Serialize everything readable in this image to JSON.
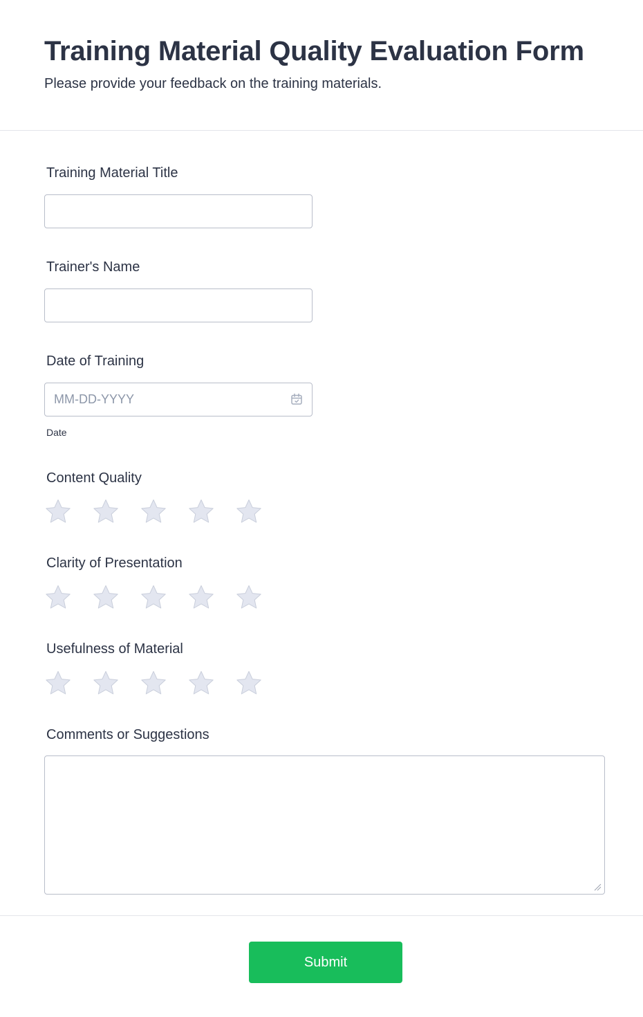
{
  "form": {
    "title": "Training Material Quality Evaluation Form",
    "subtitle": "Please provide your feedback on the training materials."
  },
  "fields": {
    "material_title": {
      "label": "Training Material Title",
      "value": ""
    },
    "trainer_name": {
      "label": "Trainer's Name",
      "value": ""
    },
    "date": {
      "label": "Date of Training",
      "placeholder": "MM-DD-YYYY",
      "sublabel": "Date",
      "icon": "calendar-icon"
    },
    "content_quality": {
      "label": "Content Quality",
      "rating": 0,
      "max": 5
    },
    "clarity": {
      "label": "Clarity of Presentation",
      "rating": 0,
      "max": 5
    },
    "usefulness": {
      "label": "Usefulness of Material",
      "rating": 0,
      "max": 5
    },
    "comments": {
      "label": "Comments or Suggestions",
      "value": ""
    }
  },
  "submit": {
    "label": "Submit"
  },
  "colors": {
    "text": "#2c3345",
    "star_fill": "#e3e6f0",
    "star_stroke": "#c9cedb",
    "button": "#18bd5b",
    "input_border": "#b8bdc9",
    "placeholder": "#8d97a9"
  }
}
